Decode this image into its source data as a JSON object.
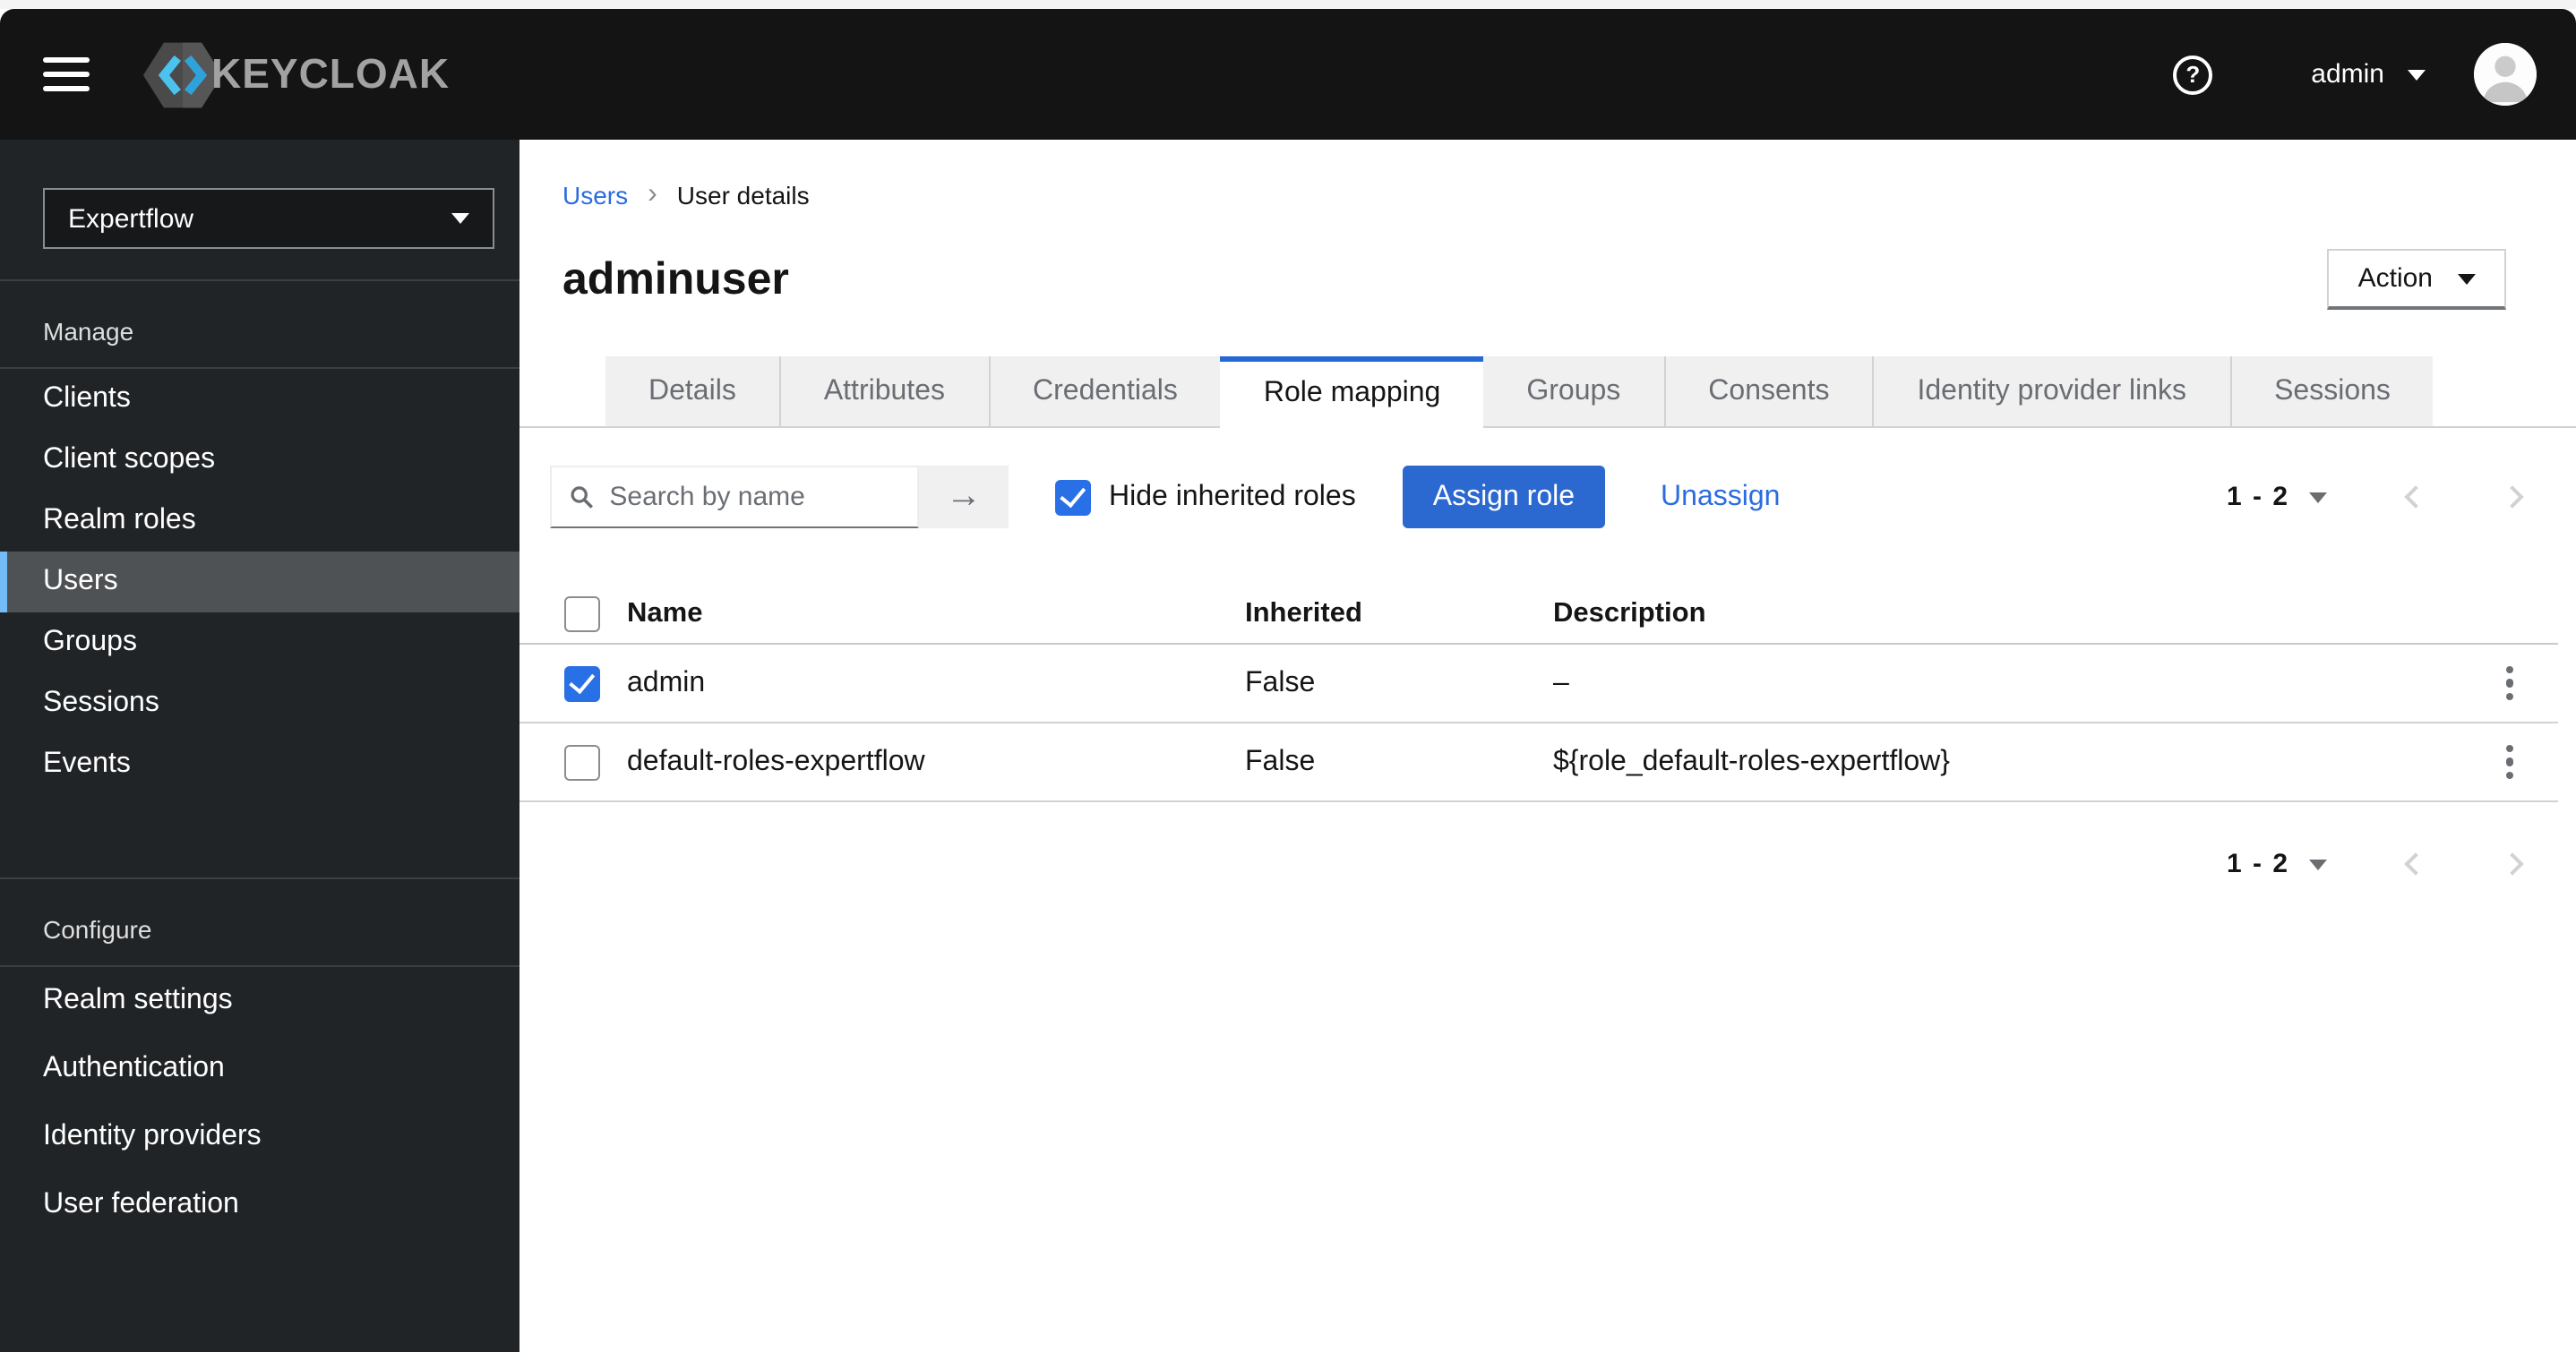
{
  "colors": {
    "masthead_bg": "#141414",
    "sidebar_bg": "#212427",
    "sidebar_divider": "#3c3f42",
    "nav_selected_bg": "#4f5255",
    "nav_accent": "#73bcf7",
    "primary_blue": "#2b68cf",
    "link_blue": "#2b6ce0",
    "checkbox_blue": "#2970e6",
    "tab_active_border": "#2368d4",
    "tab_inactive_bg": "#f0f0f0",
    "border_gray": "#d2d2d2",
    "muted_text": "#6a6e73",
    "text_dark": "#151515"
  },
  "icons": {
    "menu": "hamburger",
    "keycloak_logo": "hexagon-with-angle-brackets",
    "help": "?",
    "caret_down": "triangle-down",
    "avatar": "person-silhouette",
    "search": "magnifier",
    "arrow_right": "→",
    "breadcrumb_separator": "›",
    "kebab": "vertical-three-dots",
    "chevron_left": "angle-left",
    "chevron_right": "angle-right",
    "check": "checkmark"
  },
  "topbar": {
    "brand": "KEYCLOAK",
    "user": "admin"
  },
  "sidebar": {
    "realm_selector": {
      "value": "Expertflow"
    },
    "sections": [
      {
        "label": "Manage",
        "items": [
          {
            "label": "Clients"
          },
          {
            "label": "Client scopes"
          },
          {
            "label": "Realm roles"
          },
          {
            "label": "Users",
            "selected": true
          },
          {
            "label": "Groups"
          },
          {
            "label": "Sessions"
          },
          {
            "label": "Events"
          }
        ]
      },
      {
        "label": "Configure",
        "items": [
          {
            "label": "Realm settings"
          },
          {
            "label": "Authentication"
          },
          {
            "label": "Identity providers"
          },
          {
            "label": "User federation"
          }
        ]
      }
    ]
  },
  "breadcrumb": {
    "items": [
      {
        "label": "Users"
      },
      {
        "label": "User details"
      }
    ]
  },
  "page": {
    "title": "adminuser",
    "action_button": "Action"
  },
  "tabs": [
    {
      "label": "Details"
    },
    {
      "label": "Attributes"
    },
    {
      "label": "Credentials"
    },
    {
      "label": "Role mapping",
      "active": true
    },
    {
      "label": "Groups"
    },
    {
      "label": "Consents"
    },
    {
      "label": "Identity provider links"
    },
    {
      "label": "Sessions"
    }
  ],
  "toolbar": {
    "search_placeholder": "Search by name",
    "hide_inherited": {
      "label": "Hide inherited roles",
      "checked": true
    },
    "assign_button": "Assign role",
    "unassign_link": "Unassign",
    "pagination": {
      "range": "1 - 2"
    }
  },
  "table": {
    "header_checkbox_checked": false,
    "columns": [
      "Name",
      "Inherited",
      "Description"
    ],
    "rows": [
      {
        "checked": true,
        "name": "admin",
        "inherited": "False",
        "description": "–"
      },
      {
        "checked": false,
        "name": "default-roles-expertflow",
        "inherited": "False",
        "description": "${role_default-roles-expertflow}"
      }
    ]
  },
  "bottom_pagination": {
    "range": "1 - 2"
  }
}
